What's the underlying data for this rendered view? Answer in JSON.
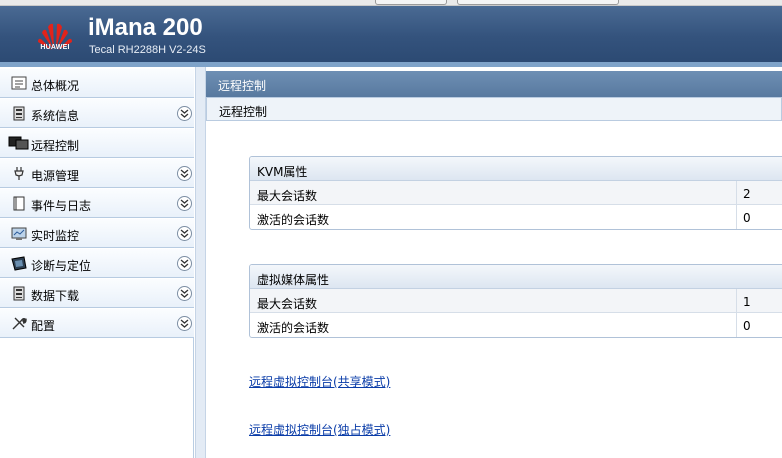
{
  "header": {
    "brand": "HUAWEI",
    "title": "iMana 200",
    "subtitle": "Tecal RH2288H V2-24S",
    "brand_color": "#e2231a",
    "bar_color": "#34537d"
  },
  "sidebar": {
    "items": [
      {
        "label": "总体概况",
        "icon": "overview-icon",
        "expandable": false
      },
      {
        "label": "系统信息",
        "icon": "system-info-icon",
        "expandable": true
      },
      {
        "label": "远程控制",
        "icon": "monitors-icon",
        "expandable": false,
        "selected": true
      },
      {
        "label": "电源管理",
        "icon": "power-plug-icon",
        "expandable": true
      },
      {
        "label": "事件与日志",
        "icon": "log-book-icon",
        "expandable": true
      },
      {
        "label": "实时监控",
        "icon": "monitor-screen-icon",
        "expandable": true
      },
      {
        "label": "诊断与定位",
        "icon": "diagnostic-icon",
        "expandable": true
      },
      {
        "label": "数据下载",
        "icon": "data-download-icon",
        "expandable": true
      },
      {
        "label": "配置",
        "icon": "tools-icon",
        "expandable": true
      }
    ]
  },
  "main": {
    "title": "远程控制",
    "subtitle": "远程控制",
    "kvm": {
      "heading": "KVM属性",
      "rows": [
        {
          "label": "最大会话数",
          "value": "2"
        },
        {
          "label": "激活的会话数",
          "value": "0"
        }
      ]
    },
    "vmedia": {
      "heading": "虚拟媒体属性",
      "rows": [
        {
          "label": "最大会话数",
          "value": "1"
        },
        {
          "label": "激活的会话数",
          "value": "0"
        }
      ]
    },
    "links": {
      "shared": "远程虚拟控制台(共享模式)",
      "exclusive": "远程虚拟控制台(独占模式)"
    }
  }
}
